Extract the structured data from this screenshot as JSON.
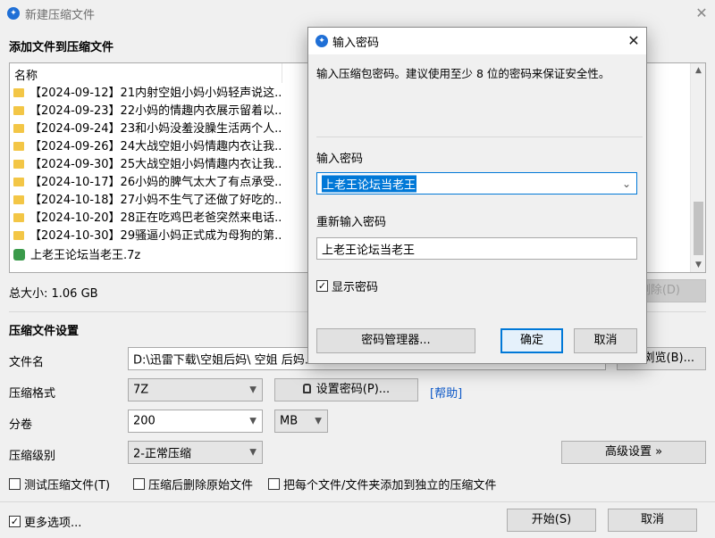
{
  "window": {
    "title": "新建压缩文件",
    "close_symbol": "✕"
  },
  "add_section": {
    "title": "添加文件到压缩文件",
    "column_name": "名称",
    "items": [
      {
        "name": "【2024-09-12】21内射空姐小妈小妈轻声说这...",
        "type": "folder"
      },
      {
        "name": "【2024-09-23】22小妈的情趣内衣展示留着以...",
        "type": "folder"
      },
      {
        "name": "【2024-09-24】23和小妈没羞没臊生活两个人...",
        "type": "folder"
      },
      {
        "name": "【2024-09-26】24大战空姐小妈情趣内衣让我...",
        "type": "folder"
      },
      {
        "name": "【2024-09-30】25大战空姐小妈情趣内衣让我...",
        "type": "folder"
      },
      {
        "name": "【2024-10-17】26小妈的脾气太大了有点承受...",
        "type": "folder"
      },
      {
        "name": "【2024-10-18】27小妈不生气了还做了好吃的...",
        "type": "folder"
      },
      {
        "name": "【2024-10-20】28正在吃鸡巴老爸突然来电话...",
        "type": "folder"
      },
      {
        "name": "【2024-10-30】29骚逼小妈正式成为母狗的第...",
        "type": "folder"
      },
      {
        "name": "上老王论坛当老王.7z",
        "type": "archive"
      }
    ],
    "total_size": "总大小: 1.06 GB",
    "delete_button": "删除(D)"
  },
  "settings": {
    "title": "压缩文件设置",
    "filename_label": "文件名",
    "filename_value": "D:\\迅雷下载\\空姐后妈\\ 空姐 后妈.7z",
    "browse_button": "浏览(B)...",
    "format_label": "压缩格式",
    "format_value": "7Z",
    "set_password_button": "设置密码(P)...",
    "help_link": "[帮助]",
    "volume_label": "分卷",
    "volume_value": "200",
    "volume_unit": "MB",
    "level_label": "压缩级别",
    "level_value": "2-正常压缩",
    "advanced_button": "高级设置 »",
    "opt_test": "测试压缩文件(T)",
    "opt_delete_after": "压缩后删除原始文件",
    "opt_each_separate": "把每个文件/文件夹添加到独立的压缩文件",
    "more_options": "更多选项...",
    "start_button": "开始(S)",
    "cancel_button": "取消"
  },
  "dialog": {
    "title": "输入密码",
    "close_symbol": "✕",
    "instruction": "输入压缩包密码。建议使用至少 8 位的密码来保证安全性。",
    "password_label": "输入密码",
    "password_value": "上老王论坛当老王",
    "reenter_label": "重新输入密码",
    "reenter_value": "上老王论坛当老王",
    "show_password": "显示密码",
    "manager_button": "密码管理器...",
    "ok_button": "确定",
    "cancel_button": "取消"
  }
}
